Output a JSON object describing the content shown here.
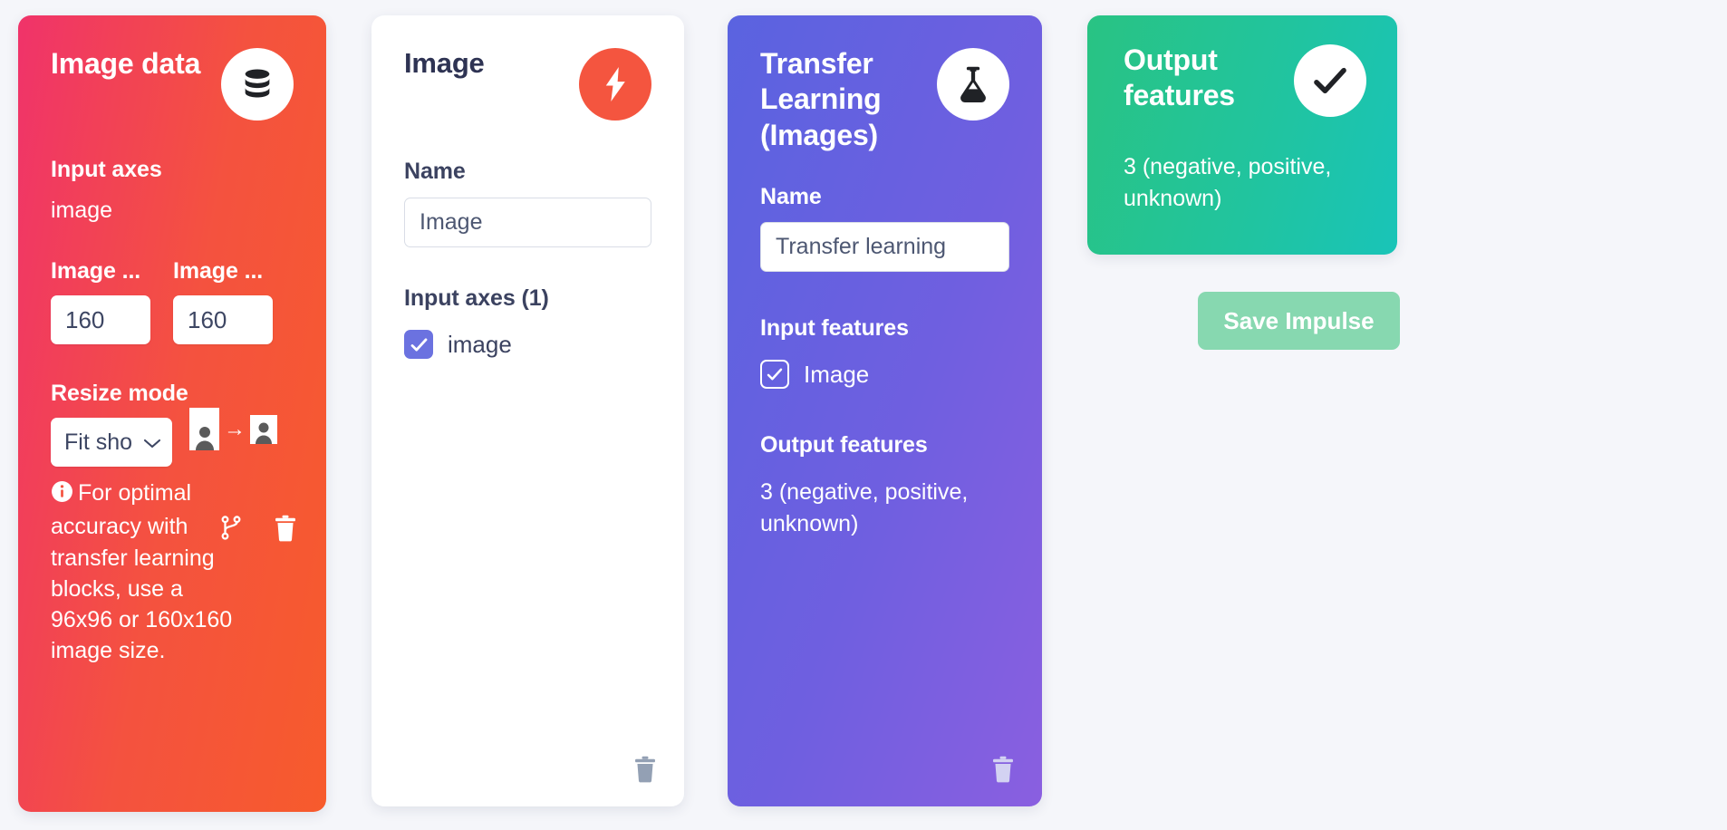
{
  "cards": {
    "image_data": {
      "title": "Image data",
      "badge_icon": "database-icon",
      "input_axes_label": "Input axes",
      "input_axes_value": "image",
      "width_label": "Image ...",
      "width_value": "160",
      "height_label": "Image ...",
      "height_value": "160",
      "resize_mode_label": "Resize mode",
      "resize_mode_value": "Fit sho",
      "hint_text": "For optimal accuracy with transfer learning blocks, use a 96x96 or 160x160 image size.",
      "branch_icon": "code-branch-icon",
      "trash_icon": "trash-icon",
      "accent": "#f4523f"
    },
    "image_block": {
      "title": "Image",
      "badge_icon": "lightning-bolt-icon",
      "name_label": "Name",
      "name_value": "Image",
      "input_axes_label": "Input axes (1)",
      "axis_option_label": "image",
      "axis_option_checked": true,
      "trash_icon": "trash-icon",
      "accent": "#f4553f"
    },
    "transfer_learning": {
      "title": "Transfer Learning (Images)",
      "badge_icon": "flask-icon",
      "name_label": "Name",
      "name_value": "Transfer learning",
      "input_features_label": "Input features",
      "input_feature_option": "Image",
      "input_feature_checked": true,
      "output_features_label": "Output features",
      "output_features_value": "3 (negative, positive, unknown)",
      "trash_icon": "trash-icon",
      "accent": "#6f5fe0"
    },
    "output_features": {
      "title": "Output features",
      "badge_icon": "check-icon",
      "value": "3 (negative, positive, unknown)",
      "accent": "#21c49e"
    }
  },
  "actions": {
    "save_impulse_label": "Save Impulse"
  }
}
